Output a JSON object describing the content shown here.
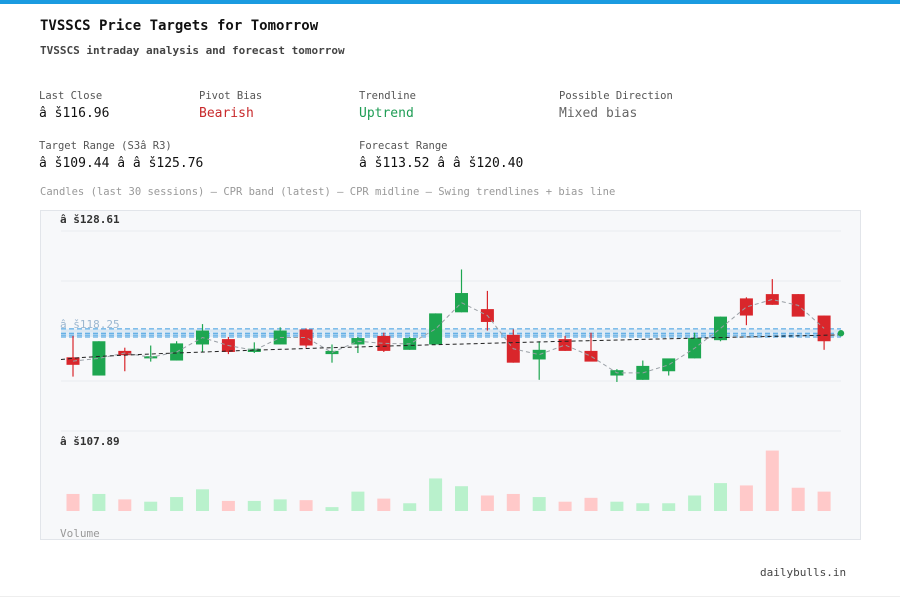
{
  "header": {
    "title": "TVSSCS Price Targets for Tomorrow",
    "subtitle": "TVSSCS intraday analysis and forecast tomorrow"
  },
  "stats": {
    "last_close": {
      "label": "Last Close",
      "value": "â š116.96"
    },
    "pivot_bias": {
      "label": "Pivot Bias",
      "value": "Bearish"
    },
    "trendline": {
      "label": "Trendline",
      "value": "Uptrend"
    },
    "direction": {
      "label": "Possible Direction",
      "value": "Mixed bias"
    },
    "target_range": {
      "label": "Target Range (S3â  R3)",
      "value": "â š109.44 â   â š125.76"
    },
    "forecast_range": {
      "label": "Forecast Range",
      "value": "â š113.52 â   â š120.40"
    }
  },
  "caption": "Candles (last 30 sessions) – CPR band (latest) – CPR midline – Swing trendlines + bias line",
  "footer": "dailybulls.in",
  "colors": {
    "accent": "#1a9be0",
    "bull": "#1ea650",
    "bear": "#d9262b",
    "bull_vol": "#b9f1cc",
    "bear_vol": "#ffc9c9",
    "cpr": "#3d9be0"
  },
  "chart_data": {
    "type": "candlestick",
    "price_labels": {
      "top": "â š128.61",
      "bottom": "â š107.89",
      "cpr": "â š118.25"
    },
    "ylim": [
      107.89,
      128.61
    ],
    "volume_label": "Volume",
    "cpr_band": [
      117.6,
      118.35
    ],
    "cpr_mid": 117.95,
    "series": [
      {
        "o": 115.7,
        "h": 117.7,
        "l": 113.9,
        "c": 115.0
      },
      {
        "o": 114.0,
        "h": 117.2,
        "l": 114.0,
        "c": 117.2
      },
      {
        "o": 116.3,
        "h": 116.6,
        "l": 114.4,
        "c": 115.9
      },
      {
        "o": 115.6,
        "h": 116.8,
        "l": 115.3,
        "c": 115.8
      },
      {
        "o": 115.4,
        "h": 117.2,
        "l": 115.4,
        "c": 117.0
      },
      {
        "o": 116.9,
        "h": 118.8,
        "l": 116.2,
        "c": 118.2
      },
      {
        "o": 117.4,
        "h": 117.6,
        "l": 116.0,
        "c": 116.2
      },
      {
        "o": 116.2,
        "h": 117.1,
        "l": 116.1,
        "c": 116.5
      },
      {
        "o": 116.9,
        "h": 118.5,
        "l": 116.9,
        "c": 118.2
      },
      {
        "o": 118.3,
        "h": 118.4,
        "l": 116.6,
        "c": 116.8
      },
      {
        "o": 116.0,
        "h": 116.9,
        "l": 115.2,
        "c": 116.3
      },
      {
        "o": 116.9,
        "h": 117.6,
        "l": 116.1,
        "c": 117.5
      },
      {
        "o": 117.7,
        "h": 118.0,
        "l": 116.2,
        "c": 116.3
      },
      {
        "o": 116.4,
        "h": 117.6,
        "l": 116.4,
        "c": 117.5
      },
      {
        "o": 116.9,
        "h": 119.8,
        "l": 116.9,
        "c": 119.8
      },
      {
        "o": 119.9,
        "h": 123.9,
        "l": 119.9,
        "c": 121.7
      },
      {
        "o": 120.2,
        "h": 121.9,
        "l": 118.2,
        "c": 119.0
      },
      {
        "o": 117.8,
        "h": 118.3,
        "l": 115.2,
        "c": 115.2
      },
      {
        "o": 115.5,
        "h": 117.2,
        "l": 113.6,
        "c": 116.4
      },
      {
        "o": 117.4,
        "h": 117.7,
        "l": 116.3,
        "c": 116.3
      },
      {
        "o": 116.3,
        "h": 118.0,
        "l": 115.6,
        "c": 115.3
      },
      {
        "o": 114.0,
        "h": 114.6,
        "l": 113.4,
        "c": 114.5
      },
      {
        "o": 113.6,
        "h": 115.4,
        "l": 113.6,
        "c": 114.9
      },
      {
        "o": 114.4,
        "h": 115.4,
        "l": 114.0,
        "c": 115.6
      },
      {
        "o": 115.6,
        "h": 118.0,
        "l": 115.6,
        "c": 117.5
      },
      {
        "o": 117.3,
        "h": 119.5,
        "l": 117.2,
        "c": 119.5
      },
      {
        "o": 121.2,
        "h": 121.3,
        "l": 118.7,
        "c": 119.6
      },
      {
        "o": 121.6,
        "h": 123.0,
        "l": 120.6,
        "c": 120.6
      },
      {
        "o": 121.6,
        "h": 121.6,
        "l": 120.6,
        "c": 119.5
      },
      {
        "o": 119.6,
        "h": 119.6,
        "l": 116.4,
        "c": 117.2
      }
    ],
    "volume": [
      22,
      22,
      15,
      12,
      18,
      28,
      13,
      13,
      15,
      14,
      5,
      25,
      16,
      10,
      42,
      32,
      20,
      22,
      18,
      12,
      17,
      12,
      10,
      10,
      20,
      36,
      33,
      78,
      30,
      25
    ]
  }
}
